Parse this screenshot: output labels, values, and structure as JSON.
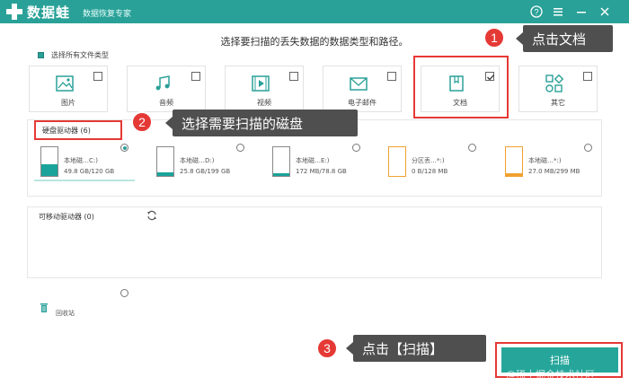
{
  "app": {
    "name": "数据蛙",
    "subtitle": "数据恢复专家"
  },
  "main": {
    "title": "选择要扫描的丢失数据的数据类型和路径。"
  },
  "select_all": {
    "label": "选择所有文件类型"
  },
  "file_types": [
    {
      "label": "图片",
      "checked": false
    },
    {
      "label": "音频",
      "checked": false
    },
    {
      "label": "视频",
      "checked": false
    },
    {
      "label": "电子邮件",
      "checked": false
    },
    {
      "label": "文档",
      "checked": true
    },
    {
      "label": "其它",
      "checked": false
    }
  ],
  "drives": {
    "label": "硬盘驱动器 (6)",
    "items": [
      {
        "name": "本地磁…C:)",
        "size": "49.8 GB/120 GB",
        "used": 0.41,
        "color": "#1aa39a",
        "selected": true
      },
      {
        "name": "本地磁…D:)",
        "size": "25.8 GB/199 GB",
        "used": 0.13,
        "color": "#1aa39a",
        "selected": false
      },
      {
        "name": "本地磁…E:)",
        "size": "172 MB/78.8 GB",
        "used": 0.01,
        "color": "#1aa39a",
        "selected": false
      },
      {
        "name": "分区丢…*:)",
        "size": "0 B/128 MB",
        "used": 0.0,
        "color": "#f0a030",
        "selected": false
      },
      {
        "name": "本地磁…*:)",
        "size": "27.0 MB/299 MB",
        "used": 0.09,
        "color": "#f0a030",
        "selected": false
      }
    ]
  },
  "removable": {
    "label": "可移动驱动器 (0)"
  },
  "recycle": {
    "label": "回收站"
  },
  "scan_button": {
    "label": "扫描"
  },
  "callouts": [
    {
      "step": "1",
      "text": "点击文档"
    },
    {
      "step": "2",
      "text": "选择需要扫描的磁盘"
    },
    {
      "step": "3",
      "text": "点击【扫描】"
    }
  ],
  "watermark": "@稀土掘金技术社区",
  "colors": {
    "accent": "#2aa198",
    "highlight": "#e53935",
    "callout_bg": "#4f4f4f"
  }
}
